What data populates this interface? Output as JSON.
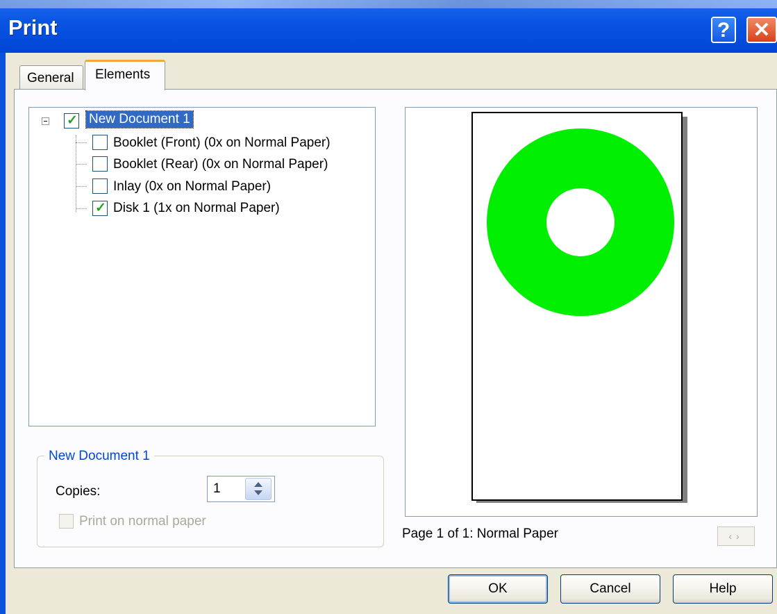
{
  "window": {
    "title": "Print",
    "help_glyph": "?",
    "close_glyph": "✕"
  },
  "tabs": [
    {
      "label": "General",
      "active": false
    },
    {
      "label": "Elements",
      "active": true
    }
  ],
  "tree": {
    "root": {
      "label": "New Document 1",
      "checked": true,
      "expanded": true
    },
    "items": [
      {
        "label": "Booklet  (Front) (0x on Normal Paper)",
        "checked": false
      },
      {
        "label": "Booklet  (Rear) (0x on Normal Paper)",
        "checked": false
      },
      {
        "label": "Inlay (0x on Normal Paper)",
        "checked": false
      },
      {
        "label": "Disk 1 (1x on Normal Paper)",
        "checked": true
      }
    ]
  },
  "group": {
    "title": "New Document 1",
    "copies_label": "Copies:",
    "copies_value": "1",
    "print_normal_label": "Print on normal paper",
    "print_normal_checked": false,
    "print_normal_enabled": false
  },
  "preview": {
    "disk_color": "#00ee00",
    "status": "Page 1 of 1: Normal Paper",
    "pager_glyphs": "‹›"
  },
  "buttons": {
    "ok": "OK",
    "cancel": "Cancel",
    "help": "Help"
  }
}
